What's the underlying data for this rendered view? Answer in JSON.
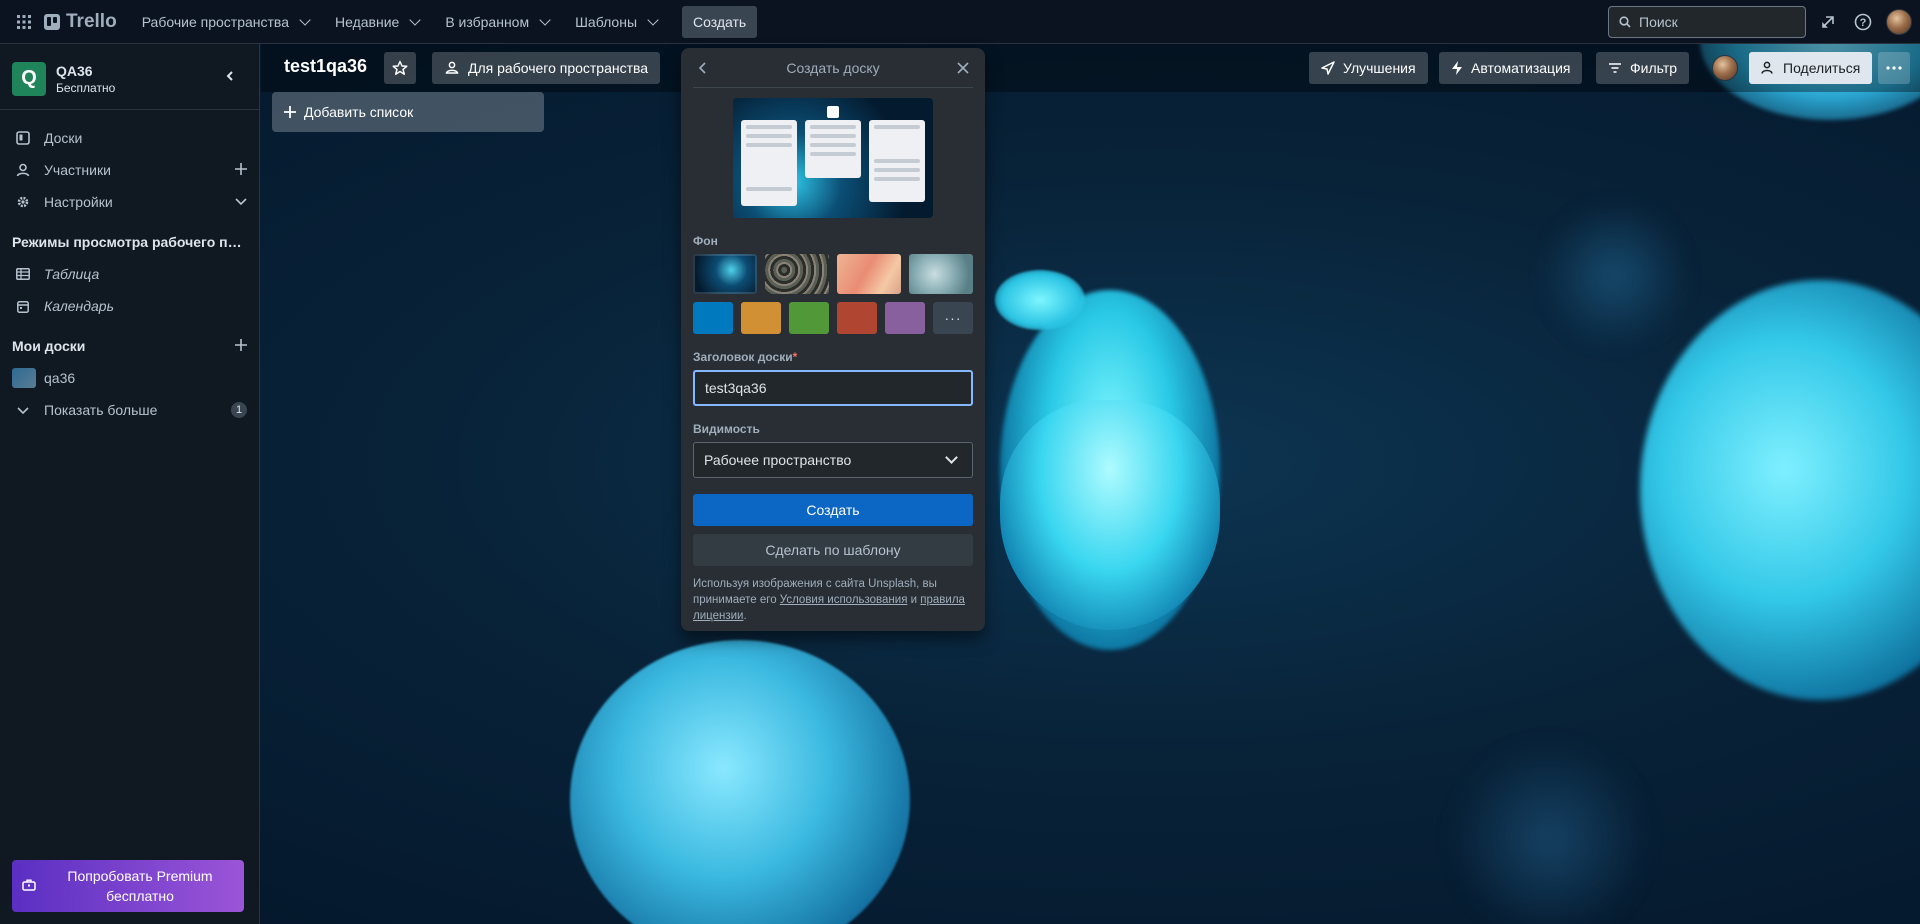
{
  "nav": {
    "brand": "Trello",
    "menu": [
      {
        "label": "Рабочие пространства"
      },
      {
        "label": "Недавние"
      },
      {
        "label": "В избранном"
      },
      {
        "label": "Шаблоны"
      }
    ],
    "create_label": "Создать",
    "search_placeholder": "Поиск"
  },
  "sidebar": {
    "workspace_initial": "Q",
    "workspace_name": "QA36",
    "workspace_plan": "Бесплатно",
    "items": [
      {
        "label": "Доски",
        "icon": "board-icon"
      },
      {
        "label": "Участники",
        "icon": "person-icon"
      },
      {
        "label": "Настройки",
        "icon": "gear-icon"
      }
    ],
    "views_section": "Режимы просмотра рабочего пространства",
    "views": [
      {
        "label": "Таблица",
        "icon": "table-icon"
      },
      {
        "label": "Календарь",
        "icon": "calendar-icon"
      }
    ],
    "my_boards_section": "Мои доски",
    "boards": [
      {
        "label": "qa36"
      }
    ],
    "show_more_label": "Показать больше",
    "show_more_count": "1",
    "premium_label": "Попробовать Premium бесплатно"
  },
  "board": {
    "title": "test1qa36",
    "visibility_label": "Для рабочего пространства",
    "powerups_label": "Улучшения",
    "automation_label": "Автоматизация",
    "filter_label": "Фильтр",
    "share_label": "Поделиться",
    "add_list_label": "Добавить список"
  },
  "create_board": {
    "title": "Создать доску",
    "background_label": "Фон",
    "board_title_label": "Заголовок доски",
    "required_mark": "*",
    "board_title_value": "test3qa36",
    "visibility_label": "Видимость",
    "visibility_value": "Рабочее пространство",
    "create_label": "Создать",
    "template_label": "Сделать по шаблону",
    "legal_text_1": "Используя изображения с сайта Unsplash, вы принимаете его ",
    "legal_link_1": "Условия использования",
    "legal_text_2": " и ",
    "legal_link_2": "правила лицензии",
    "legal_text_3": ".",
    "more_label": "···",
    "colors": [
      "#0079bf",
      "#d29034",
      "#519839",
      "#b04632",
      "#89609e"
    ]
  },
  "colors": {
    "nav_bg": "#0b1320",
    "sidebar_bg": "#101921",
    "primary": "#0c66c4",
    "workspace_badge": "#1f845a",
    "premium_from": "#5a2fc2",
    "premium_to": "#9b55d8"
  }
}
